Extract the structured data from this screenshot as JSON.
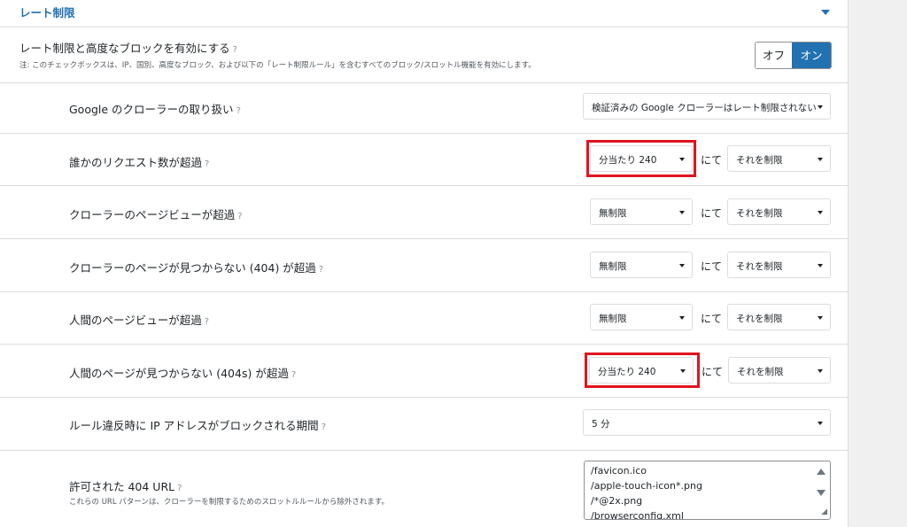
{
  "section": {
    "title": "レート制限"
  },
  "enable": {
    "label": "レート制限と高度なブロックを有効にする",
    "note": "注: このチェックボックスは、IP、国別、高度なブロック、および以下の「レート制限ルール」を含むすべてのブロック/スロットル機能を有効にします。",
    "off": "オフ",
    "on": "オン"
  },
  "help_icon": "?",
  "rows": {
    "google": {
      "label": "Google のクローラーの取り扱い",
      "value": "検証済みの Google クローラーはレート制限されない"
    },
    "requests": {
      "label": "誰かのリクエスト数が超過",
      "value": "分当たり 240",
      "connector": "にて",
      "action": "それを制限"
    },
    "crawler_views": {
      "label": "クローラーのページビューが超過",
      "value": "無制限",
      "connector": "にて",
      "action": "それを制限"
    },
    "crawler_404": {
      "label": "クローラーのページが見つからない (404) が超過",
      "value": "無制限",
      "connector": "にて",
      "action": "それを制限"
    },
    "human_views": {
      "label": "人間のページビューが超過",
      "value": "無制限",
      "connector": "にて",
      "action": "それを制限"
    },
    "human_404": {
      "label": "人間のページが見つからない (404s) が超過",
      "value": "分当たり 240",
      "connector": "にて",
      "action": "それを制限"
    },
    "block_period": {
      "label": "ルール違反時に IP アドレスがブロックされる期間",
      "value": "5 分"
    },
    "allowed_404": {
      "label": "許可された 404 URL",
      "note": "これらの URL パターンは、クローラーを制限するためのスロットルルールから除外されます。",
      "lines": [
        "/favicon.ico",
        "/apple-touch-icon*.png",
        "/*@2x.png",
        "/browserconfig.xml"
      ]
    }
  },
  "colors": {
    "accent": "#2271b1",
    "highlight": "#e0141e"
  },
  "icons": [
    "chevron-down-icon",
    "help-icon",
    "dropdown-caret-icon",
    "scroll-up-icon",
    "scroll-down-icon",
    "resize-handle-icon"
  ]
}
